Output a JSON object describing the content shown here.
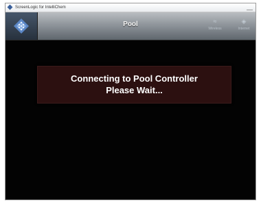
{
  "window": {
    "title": "ScreenLogic for IntelliChem",
    "background_color": "#050505"
  },
  "header": {
    "logo_icon": "pentair-diamond-logo",
    "page_title": "Pool",
    "buttons": [
      {
        "label": "Wireless",
        "icon": "wireless-icon"
      },
      {
        "label": "Internet",
        "icon": "internet-icon"
      }
    ]
  },
  "dialog": {
    "line1": "Connecting to Pool Controller",
    "line2": "Please Wait...",
    "background_color": "#2c1010"
  }
}
